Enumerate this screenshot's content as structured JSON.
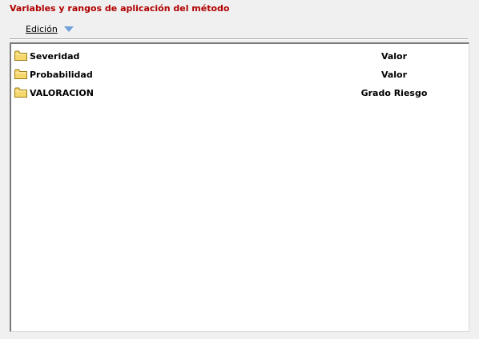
{
  "title": "Variables y rangos de aplicación del método",
  "menu": {
    "edicion_label": "Edición"
  },
  "tree": {
    "rows": [
      {
        "label": "Severidad",
        "value": "Valor"
      },
      {
        "label": "Probabilidad",
        "value": "Valor"
      },
      {
        "label": "VALORACION",
        "value": "Grado Riesgo"
      }
    ]
  },
  "colors": {
    "title": "#b00000",
    "folder": "#f5d76e",
    "dropdown_arrow": "#6f9fd8"
  },
  "icons": {
    "folder": "folder-icon",
    "dropdown": "dropdown-arrow-icon"
  }
}
